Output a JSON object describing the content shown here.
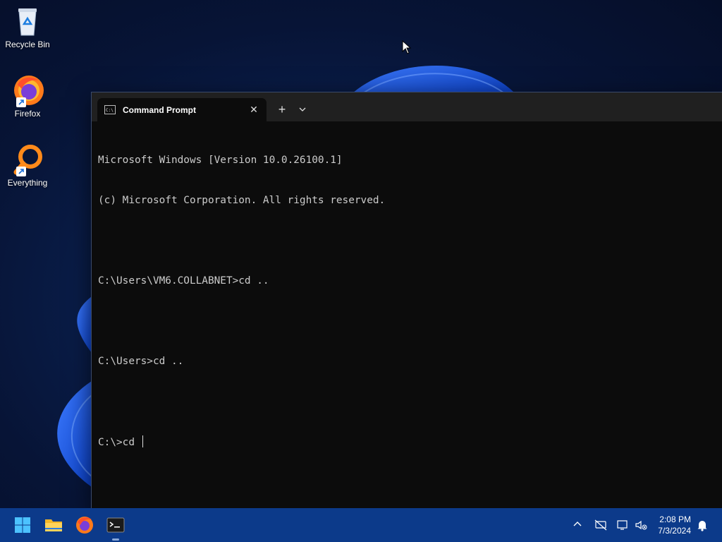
{
  "desktop": {
    "icons": [
      {
        "label": "Recycle Bin",
        "icon": "recycle-bin-icon"
      },
      {
        "label": "Firefox",
        "icon": "firefox-icon"
      },
      {
        "label": "Everything",
        "icon": "everything-search-icon"
      }
    ]
  },
  "terminal": {
    "tab_title": "Command Prompt",
    "new_tab_label": "+",
    "close_label": "✕",
    "lines": [
      "Microsoft Windows [Version 10.0.26100.1]",
      "(c) Microsoft Corporation. All rights reserved.",
      "",
      "C:\\Users\\VM6.COLLABNET>cd ..",
      "",
      "C:\\Users>cd ..",
      "",
      "C:\\>cd "
    ]
  },
  "taskbar": {
    "apps": [
      "start-icon",
      "file-explorer-icon",
      "firefox-icon",
      "terminal-icon"
    ],
    "clock_time": "2:08 PM",
    "clock_date": "7/3/2024"
  },
  "colors": {
    "taskbar": "#0c3a8a",
    "terminal_bg": "#0c0c0c",
    "terminal_text": "#cccccc"
  }
}
